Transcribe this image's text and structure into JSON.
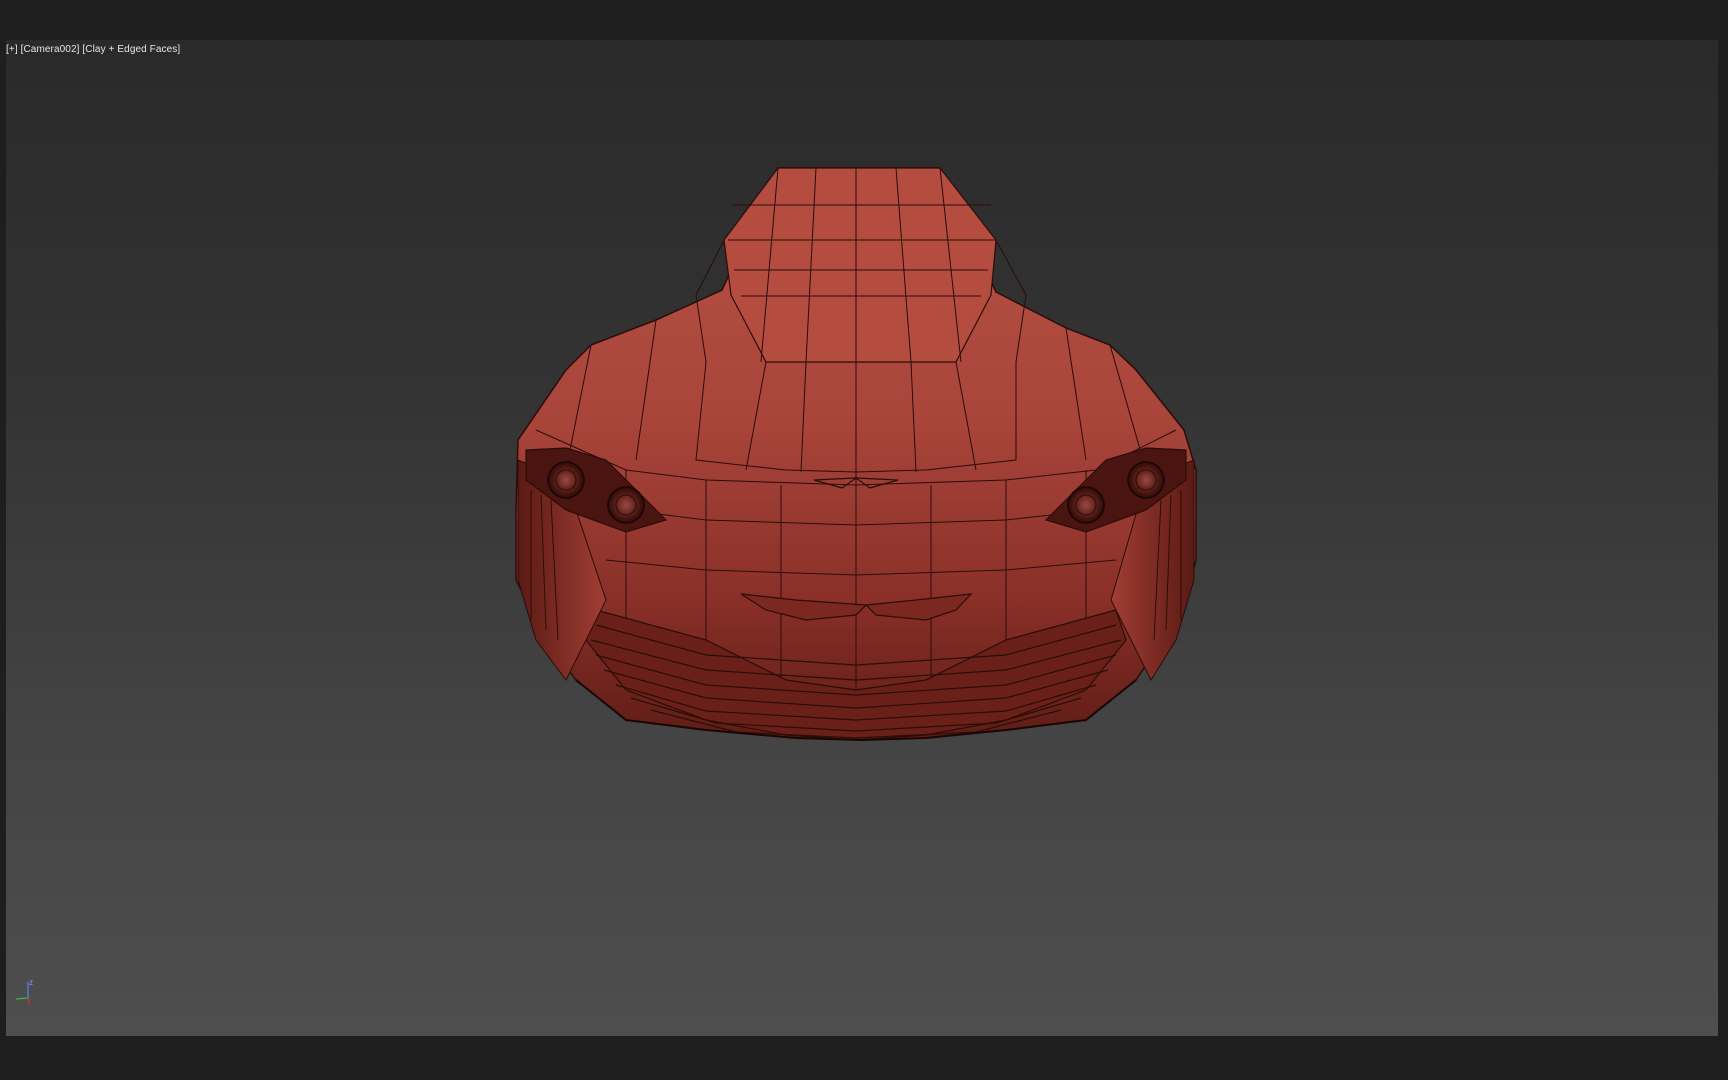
{
  "viewport": {
    "label_plus": "[+]",
    "label_camera": "[Camera002]",
    "label_shading": "[Clay + Edged Faces]",
    "gizmo_axis_label": "z",
    "background_top": "#2a2a2a",
    "background_bottom": "#4e4e4e"
  },
  "model": {
    "kind": "car-front-view-wireframe",
    "clay_color": "#b2473b",
    "edge_color": "#2a0d09"
  },
  "colors": {
    "app_frame": "#1e1e1e",
    "axis_x": "#e03030",
    "axis_y": "#30c030",
    "axis_z": "#5080ff"
  }
}
